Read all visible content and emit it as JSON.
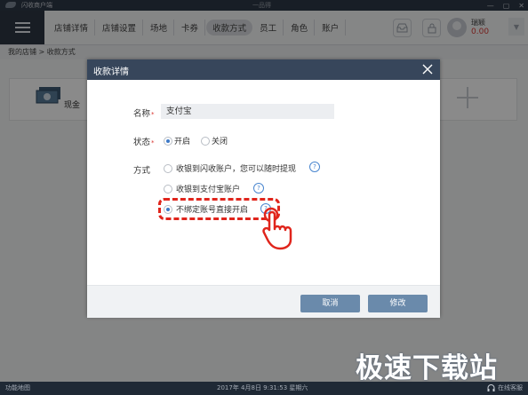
{
  "window": {
    "app_title": "闪收商户端",
    "center_logo": "一品得",
    "controls": {
      "minimize": "—",
      "maximize": "▢",
      "close": "✕"
    }
  },
  "nav": {
    "tabs": [
      {
        "label": "店铺详情",
        "active": false
      },
      {
        "label": "店铺设置",
        "active": false
      },
      {
        "label": "场地",
        "active": false
      },
      {
        "label": "卡券",
        "active": false
      },
      {
        "label": "收款方式",
        "active": true
      },
      {
        "label": "员工",
        "active": false
      },
      {
        "label": "角色",
        "active": false
      },
      {
        "label": "账户",
        "active": false
      }
    ],
    "icons": [
      "inbox-icon",
      "lock-icon"
    ],
    "user": {
      "name": "瑞颖",
      "balance": "0.00"
    },
    "dropdown": "▼"
  },
  "breadcrumb": "我的店铺 > 收款方式",
  "background_card": {
    "cash_label": "现金"
  },
  "dialog": {
    "title": "收款详情",
    "name_label": "名称",
    "name_value": "支付宝",
    "status_label": "状态",
    "status_options": [
      {
        "label": "开启",
        "checked": true
      },
      {
        "label": "关闭",
        "checked": false
      }
    ],
    "method_label": "方式",
    "method_options": [
      {
        "label": "收银到闪收账户，您可以随时提现",
        "checked": false
      },
      {
        "label": "收银到支付宝账户",
        "checked": false
      },
      {
        "label": "不绑定账号直接开启",
        "checked": true
      }
    ],
    "help_glyph": "?",
    "required_mark": "*",
    "cancel_label": "取消",
    "edit_label": "修改"
  },
  "watermark": "极速下载站",
  "status": {
    "left": "功能地图",
    "time": "2017年 4月8日  9:31:53  星期六",
    "support": "在线客服"
  },
  "colors": {
    "dialog_header": "#37465b",
    "button": "#6a8aab",
    "highlight": "#e0251c",
    "radio_checked": "#3d79c7"
  }
}
